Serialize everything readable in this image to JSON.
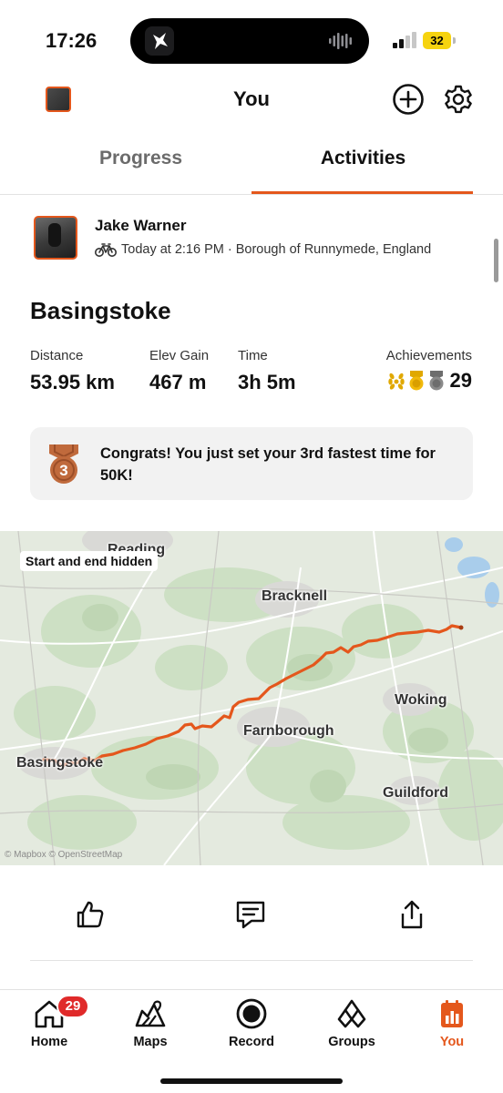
{
  "status_bar": {
    "time": "17:26",
    "battery": "32"
  },
  "header": {
    "title": "You"
  },
  "tabs": [
    {
      "label": "Progress",
      "active": false
    },
    {
      "label": "Activities",
      "active": true
    }
  ],
  "activity": {
    "athlete": "Jake Warner",
    "meta": "Today at 2:16 PM · Borough of Runnymede, England",
    "sport_icon": "bike-icon",
    "title": "Basingstoke",
    "stats": [
      {
        "label": "Distance",
        "value": "53.95 km"
      },
      {
        "label": "Elev Gain",
        "value": "467 m"
      },
      {
        "label": "Time",
        "value": "3h 5m"
      }
    ],
    "achievements": {
      "label": "Achievements",
      "count": "29",
      "icons": [
        "laurel-icon",
        "gold-medal-icon",
        "segment-medal-icon"
      ]
    },
    "congrats": {
      "text": "Congrats! You just set your 3rd fastest time for 50K!",
      "medal_number": "3"
    }
  },
  "map": {
    "badge": "Start and end hidden",
    "places": [
      "Reading",
      "Bracknell",
      "Woking",
      "Farnborough",
      "Basingstoke",
      "Guildford"
    ],
    "credit": "© Mapbox © OpenStreetMap",
    "route_color": "#e4571c"
  },
  "nav": [
    {
      "label": "Home",
      "icon": "home-icon",
      "badge": "29"
    },
    {
      "label": "Maps",
      "icon": "maps-icon"
    },
    {
      "label": "Record",
      "icon": "record-icon"
    },
    {
      "label": "Groups",
      "icon": "groups-icon"
    },
    {
      "label": "You",
      "icon": "you-icon",
      "active": true
    }
  ],
  "colors": {
    "accent": "#e4571c",
    "badge": "#e02a2a",
    "battery": "#f6d30f"
  }
}
